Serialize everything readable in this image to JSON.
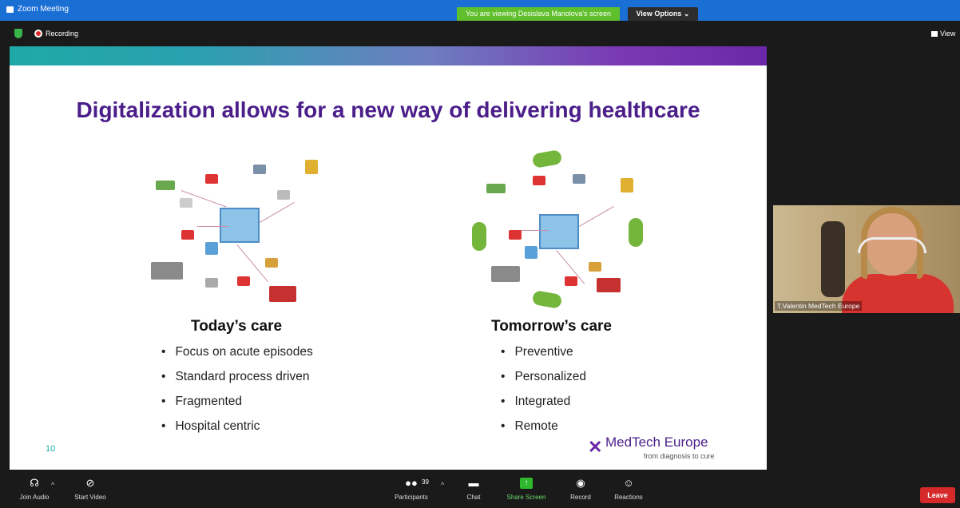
{
  "window": {
    "title": "Zoom Meeting",
    "viewing_banner": "You are viewing Desislava Manolova's screen",
    "view_options": "View Options ⌄"
  },
  "topbar": {
    "recording": "Recording",
    "view": "View"
  },
  "slide": {
    "title": "Digitalization allows for a new way of delivering healthcare",
    "left": {
      "heading": "Today’s care",
      "bullets": [
        "Focus on acute episodes",
        "Standard process driven",
        "Fragmented",
        "Hospital centric"
      ]
    },
    "right": {
      "heading": "Tomorrow’s care",
      "bullets": [
        "Preventive",
        "Personalized",
        "Integrated",
        "Remote"
      ]
    },
    "page_number": "10",
    "logo": {
      "name": "MedTech Europe",
      "tagline": "from diagnosis to cure"
    }
  },
  "video": {
    "participant_name": "T.Valentin MedTech Europe"
  },
  "toolbar": {
    "join_audio": "Join Audio",
    "start_video": "Start Video",
    "participants": "Participants",
    "participant_count": "39",
    "chat": "Chat",
    "share_screen": "Share Screen",
    "record": "Record",
    "reactions": "Reactions",
    "leave": "Leave"
  },
  "colors": {
    "zoom_blue": "#1a6fd4",
    "banner_green": "#5fbf2c",
    "title_purple": "#4b1e8a",
    "leave_red": "#d62a2a"
  }
}
